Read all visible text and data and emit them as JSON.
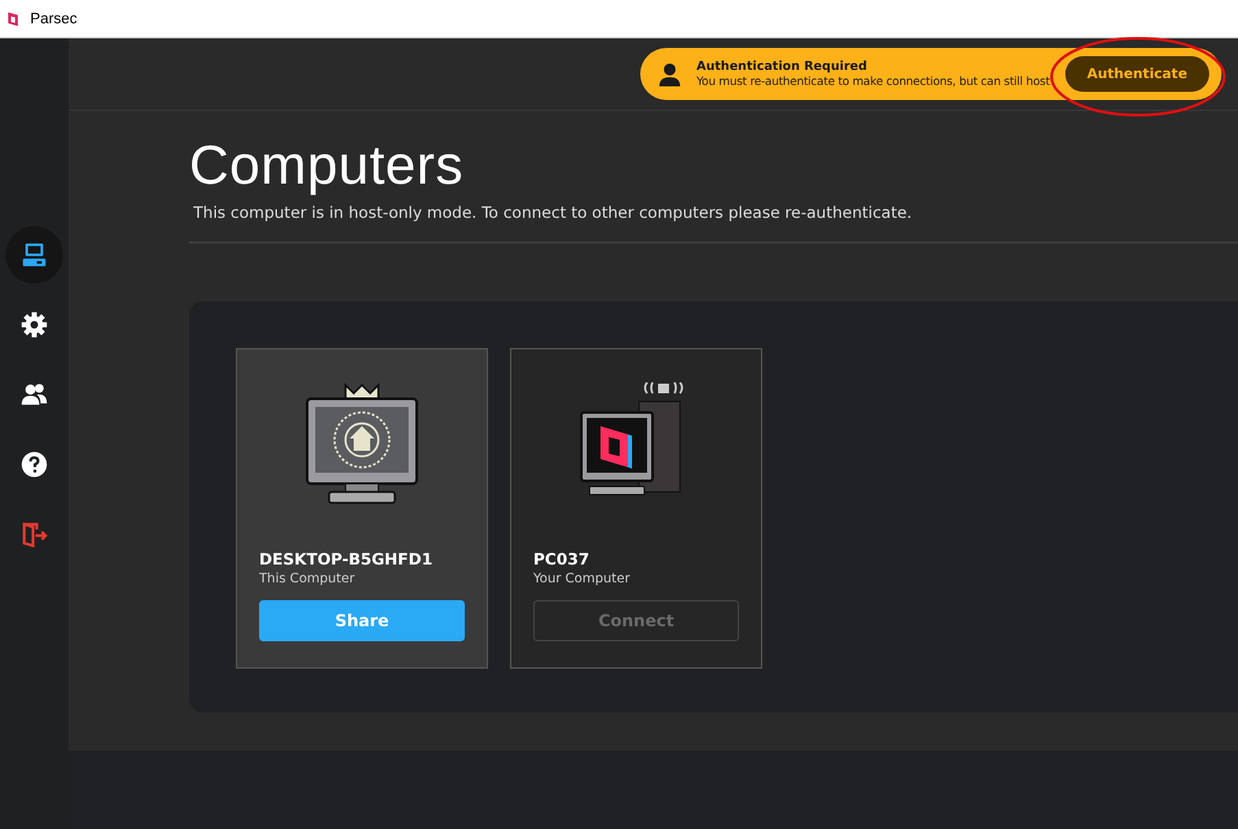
{
  "window": {
    "title": "Parsec"
  },
  "sidebar": {
    "items": [
      {
        "kind": "computers",
        "selected": true
      },
      {
        "kind": "settings",
        "selected": false
      },
      {
        "kind": "friends",
        "selected": false
      },
      {
        "kind": "help",
        "selected": false
      },
      {
        "kind": "logout",
        "selected": false
      }
    ]
  },
  "banner": {
    "title": "Authentication Required",
    "message": "You must re-authenticate to make connections, but can still host",
    "button": "Authenticate"
  },
  "page": {
    "title": "Computers",
    "subtitle": "This computer is in host-only mode. To connect to other computers please re-authenticate."
  },
  "computers": [
    {
      "kind": "host",
      "name": "DESKTOP-B5GHFD1",
      "subtitle": "This Computer",
      "button": "Share",
      "disabled": false,
      "selected": true
    },
    {
      "kind": "remote",
      "name": "PC037",
      "subtitle": "Your Computer",
      "button": "Connect",
      "disabled": true,
      "selected": false
    }
  ]
}
